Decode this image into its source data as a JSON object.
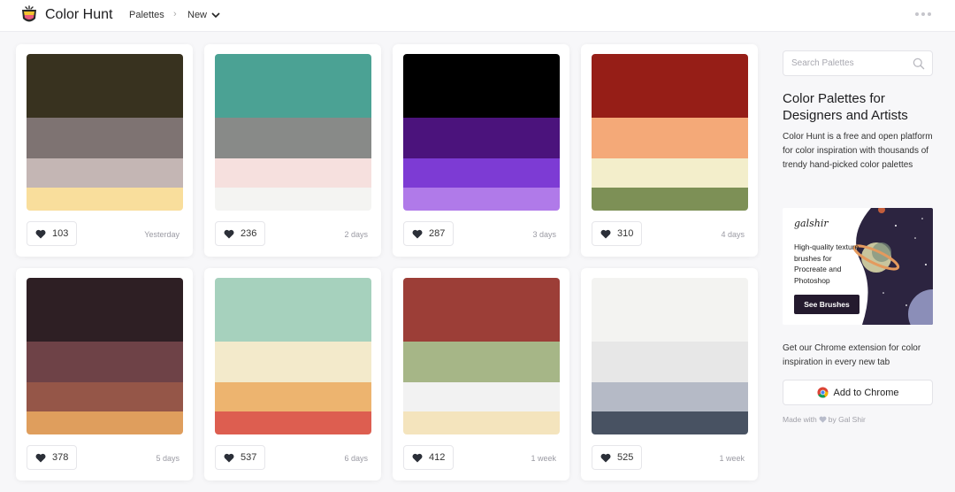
{
  "header": {
    "brand": "Color Hunt",
    "nav_palettes": "Palettes",
    "nav_separator": "›",
    "nav_new": "New",
    "icons": [
      "logo-icon",
      "chevron-down-icon",
      "more-icon"
    ]
  },
  "palettes": [
    {
      "colors": [
        "#38321F",
        "#7E7372",
        "#C4B6B4",
        "#F9DE9C"
      ],
      "likes": "103",
      "date": "Yesterday"
    },
    {
      "colors": [
        "#4BA294",
        "#888A88",
        "#F6E0DE",
        "#F4F4F2"
      ],
      "likes": "236",
      "date": "2 days"
    },
    {
      "colors": [
        "#000000",
        "#4B137C",
        "#7D3BD4",
        "#B07AE9"
      ],
      "likes": "287",
      "date": "3 days"
    },
    {
      "colors": [
        "#961E17",
        "#F4A978",
        "#F3EECB",
        "#7D9056"
      ],
      "likes": "310",
      "date": "4 days"
    },
    {
      "colors": [
        "#2E1F24",
        "#6E4247",
        "#955648",
        "#DF9E5D"
      ],
      "likes": "378",
      "date": "5 days"
    },
    {
      "colors": [
        "#A6D1BD",
        "#F3EACB",
        "#EDB46F",
        "#DD5E50"
      ],
      "likes": "537",
      "date": "6 days"
    },
    {
      "colors": [
        "#9C3E37",
        "#A6B687",
        "#F2F2F2",
        "#F4E4BD"
      ],
      "likes": "412",
      "date": "1 week"
    },
    {
      "colors": [
        "#F3F3F1",
        "#E7E7E7",
        "#B5BAC6",
        "#485262"
      ],
      "likes": "525",
      "date": "1 week"
    }
  ],
  "sidebar": {
    "search_placeholder": "Search Palettes",
    "title": "Color Palettes for Designers and Artists",
    "description": "Color Hunt is a free and open platform for color inspiration with thousands of trendy hand-picked color palettes",
    "ad": {
      "brand": "galshir",
      "text": "High-quality texture brushes for Procreate and Photoshop",
      "button": "See Brushes"
    },
    "extension_text": "Get our Chrome extension for color inspiration in every new tab",
    "chrome_button": "Add to Chrome",
    "made_with_prefix": "Made with",
    "made_with_suffix": "by Gal Shir"
  },
  "colors": {
    "accent_dark": "#241A2E",
    "heart": "#2B2F38",
    "muted_text": "#9A9AA3"
  }
}
